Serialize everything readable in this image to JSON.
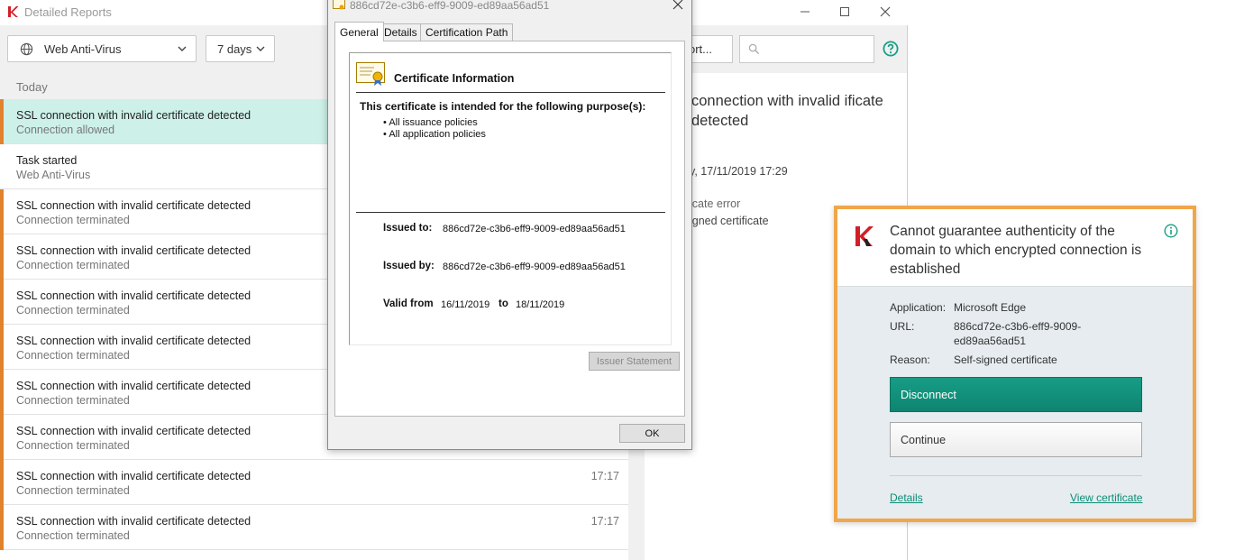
{
  "reports": {
    "title": "Detailed Reports",
    "component_filter": "Web Anti-Virus",
    "period_filter": "7 days",
    "export_label": "ort...",
    "search_placeholder": "",
    "group_label": "Today",
    "events": [
      {
        "title": "SSL connection with invalid certificate detected",
        "subtitle": "Connection allowed",
        "time": "",
        "selected": true,
        "warning": true
      },
      {
        "title": "Task started",
        "subtitle": "Web Anti-Virus",
        "time": "",
        "selected": false,
        "warning": false
      },
      {
        "title": "SSL connection with invalid certificate detected",
        "subtitle": "Connection terminated",
        "time": "",
        "selected": false,
        "warning": true
      },
      {
        "title": "SSL connection with invalid certificate detected",
        "subtitle": "Connection terminated",
        "time": "",
        "selected": false,
        "warning": true
      },
      {
        "title": "SSL connection with invalid certificate detected",
        "subtitle": "Connection terminated",
        "time": "",
        "selected": false,
        "warning": true
      },
      {
        "title": "SSL connection with invalid certificate detected",
        "subtitle": "Connection terminated",
        "time": "",
        "selected": false,
        "warning": true
      },
      {
        "title": "SSL connection with invalid certificate detected",
        "subtitle": "Connection terminated",
        "time": "",
        "selected": false,
        "warning": true
      },
      {
        "title": "SSL connection with invalid certificate detected",
        "subtitle": "Connection terminated",
        "time": "",
        "selected": false,
        "warning": true
      },
      {
        "title": "SSL connection with invalid certificate detected",
        "subtitle": "Connection terminated",
        "time": "17:17",
        "selected": false,
        "warning": true
      },
      {
        "title": "SSL connection with invalid certificate detected",
        "subtitle": "Connection terminated",
        "time": "17:17",
        "selected": false,
        "warning": true
      }
    ],
    "detail": {
      "title": "connection with invalid ificate detected",
      "date": "y, 17/11/2019 17:29",
      "type": "icate error",
      "reason": "igned certificate"
    }
  },
  "certificate": {
    "title": "886cd72e-c3b6-eff9-9009-ed89aa56ad51",
    "tabs": [
      "General",
      "Details",
      "Certification Path"
    ],
    "heading": "Certificate Information",
    "purpose_heading": "This certificate is intended for the following purpose(s):",
    "purposes": [
      "All issuance policies",
      "All application policies"
    ],
    "issued_to_label": "Issued to:",
    "issued_to": "886cd72e-c3b6-eff9-9009-ed89aa56ad51",
    "issued_by_label": "Issued by:",
    "issued_by": "886cd72e-c3b6-eff9-9009-ed89aa56ad51",
    "valid_from_label": "Valid from",
    "valid_from": "16/11/2019",
    "to_label": "to",
    "valid_to": "18/11/2019",
    "issuer_statement_label": "Issuer Statement",
    "ok_label": "OK"
  },
  "notification": {
    "title": "Cannot guarantee authenticity of the domain to which encrypted connection is established",
    "application_label": "Application:",
    "application": "Microsoft Edge",
    "url_label": "URL:",
    "url": "886cd72e-c3b6-eff9-9009-ed89aa56ad51",
    "reason_label": "Reason:",
    "reason": "Self-signed certificate",
    "disconnect_label": "Disconnect",
    "continue_label": "Continue",
    "details_link": "Details",
    "view_certificate_link": "View certificate"
  },
  "colors": {
    "accent_green": "#0f8470",
    "warning_orange": "#e2822d",
    "selected_row": "#cdf1e8",
    "notification_border": "#f0a64a",
    "kaspersky_red": "#d21f26"
  }
}
